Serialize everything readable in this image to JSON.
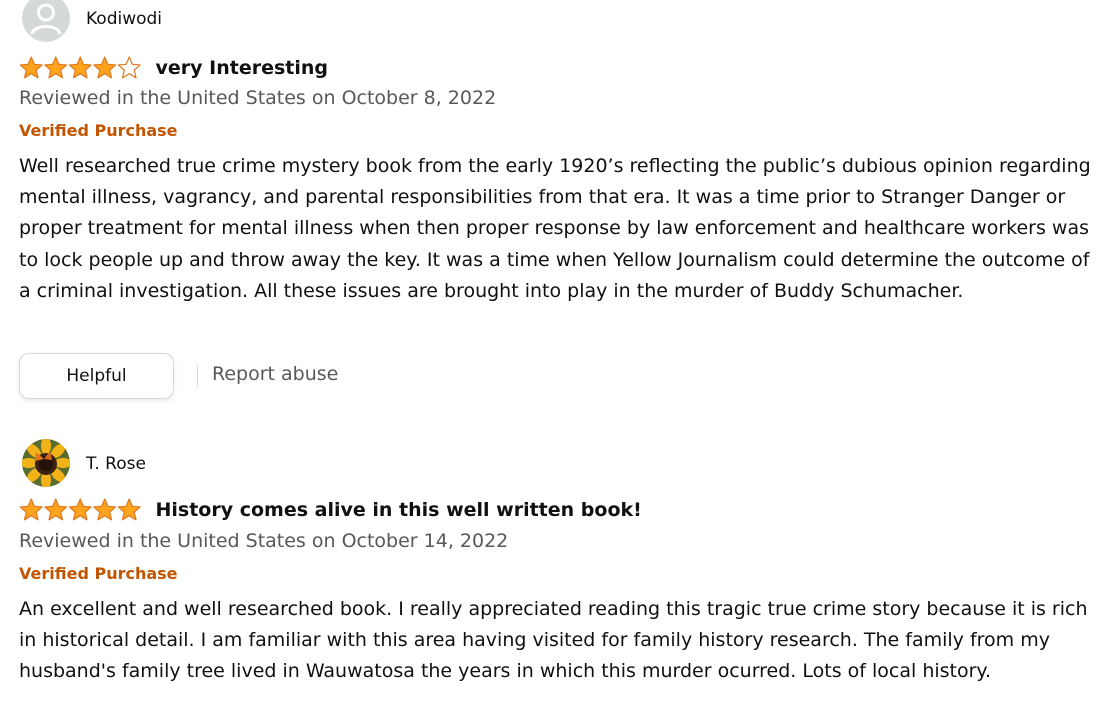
{
  "colors": {
    "star_fill": "#ffa41c",
    "star_stroke": "#de7921",
    "verified": "#c45500",
    "muted_text": "#565959"
  },
  "reviews": [
    {
      "author": "Kodiwodi",
      "avatar_icon": "default-user-avatar-icon",
      "rating": 4,
      "title": "very Interesting",
      "date": "Reviewed in the United States on October 8, 2022",
      "verified": "Verified Purchase",
      "body": "Well researched true crime mystery book from the early 1920’s reflecting the public’s dubious opinion regarding mental illness, vagrancy, and parental responsibilities from that era. It was a time prior to Stranger Danger or proper treatment for mental illness when then proper response by law enforcement and healthcare workers was to lock people up and throw away the key. It was a time when Yellow Journalism could determine the outcome of a criminal investigation. All these issues are brought into play in the murder of Buddy Schumacher.",
      "helpful_label": "Helpful",
      "report_label": "Report abuse"
    },
    {
      "author": "T. Rose",
      "avatar_icon": "sunflower-butterfly-avatar-icon",
      "rating": 5,
      "title": "History comes alive in this well written book!",
      "date": "Reviewed in the United States on October 14, 2022",
      "verified": "Verified Purchase",
      "body": "An excellent and well researched book. I really appreciated reading this tragic true crime story because it is rich in historical detail. I am familiar with this area having visited for family history research. The family from my husband's family tree lived in Wauwatosa the years in which this murder ocurred. Lots of local history."
    }
  ]
}
